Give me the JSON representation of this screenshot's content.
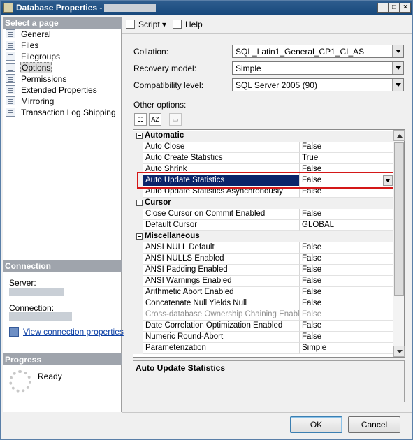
{
  "window": {
    "title": "Database Properties - "
  },
  "select_page": {
    "header": "Select a page",
    "items": [
      {
        "label": "General"
      },
      {
        "label": "Files"
      },
      {
        "label": "Filegroups"
      },
      {
        "label": "Options"
      },
      {
        "label": "Permissions"
      },
      {
        "label": "Extended Properties"
      },
      {
        "label": "Mirroring"
      },
      {
        "label": "Transaction Log Shipping"
      }
    ]
  },
  "connection": {
    "header": "Connection",
    "server_label": "Server:",
    "connection_label": "Connection:",
    "view_link": "View connection properties"
  },
  "progress": {
    "header": "Progress",
    "status": "Ready"
  },
  "toolbar": {
    "script_label": "Script",
    "help_label": "Help"
  },
  "form": {
    "collation_label": "Collation:",
    "collation_value": "SQL_Latin1_General_CP1_CI_AS",
    "recovery_label": "Recovery model:",
    "recovery_value": "Simple",
    "compat_label": "Compatibility level:",
    "compat_value": "SQL Server 2005 (90)",
    "other_options_label": "Other options:"
  },
  "grid": {
    "categories": {
      "automatic": "Automatic",
      "cursor": "Cursor",
      "misc": "Miscellaneous"
    },
    "rows": [
      {
        "name": "Auto Close",
        "value": "False"
      },
      {
        "name": "Auto Create Statistics",
        "value": "True"
      },
      {
        "name": "Auto Shrink",
        "value": "False"
      },
      {
        "name": "Auto Update Statistics",
        "value": "False"
      },
      {
        "name": "Auto Update Statistics Asynchronously",
        "value": "False"
      },
      {
        "name": "Close Cursor on Commit Enabled",
        "value": "False"
      },
      {
        "name": "Default Cursor",
        "value": "GLOBAL"
      },
      {
        "name": "ANSI NULL Default",
        "value": "False"
      },
      {
        "name": "ANSI NULLS Enabled",
        "value": "False"
      },
      {
        "name": "ANSI Padding Enabled",
        "value": "False"
      },
      {
        "name": "ANSI Warnings Enabled",
        "value": "False"
      },
      {
        "name": "Arithmetic Abort Enabled",
        "value": "False"
      },
      {
        "name": "Concatenate Null Yields Null",
        "value": "False"
      },
      {
        "name": "Cross-database Ownership Chaining Enabled",
        "value": "False"
      },
      {
        "name": "Date Correlation Optimization Enabled",
        "value": "False"
      },
      {
        "name": "Numeric Round-Abort",
        "value": "False"
      },
      {
        "name": "Parameterization",
        "value": "Simple"
      }
    ],
    "description_title": "Auto Update Statistics"
  },
  "buttons": {
    "ok": "OK",
    "cancel": "Cancel"
  }
}
